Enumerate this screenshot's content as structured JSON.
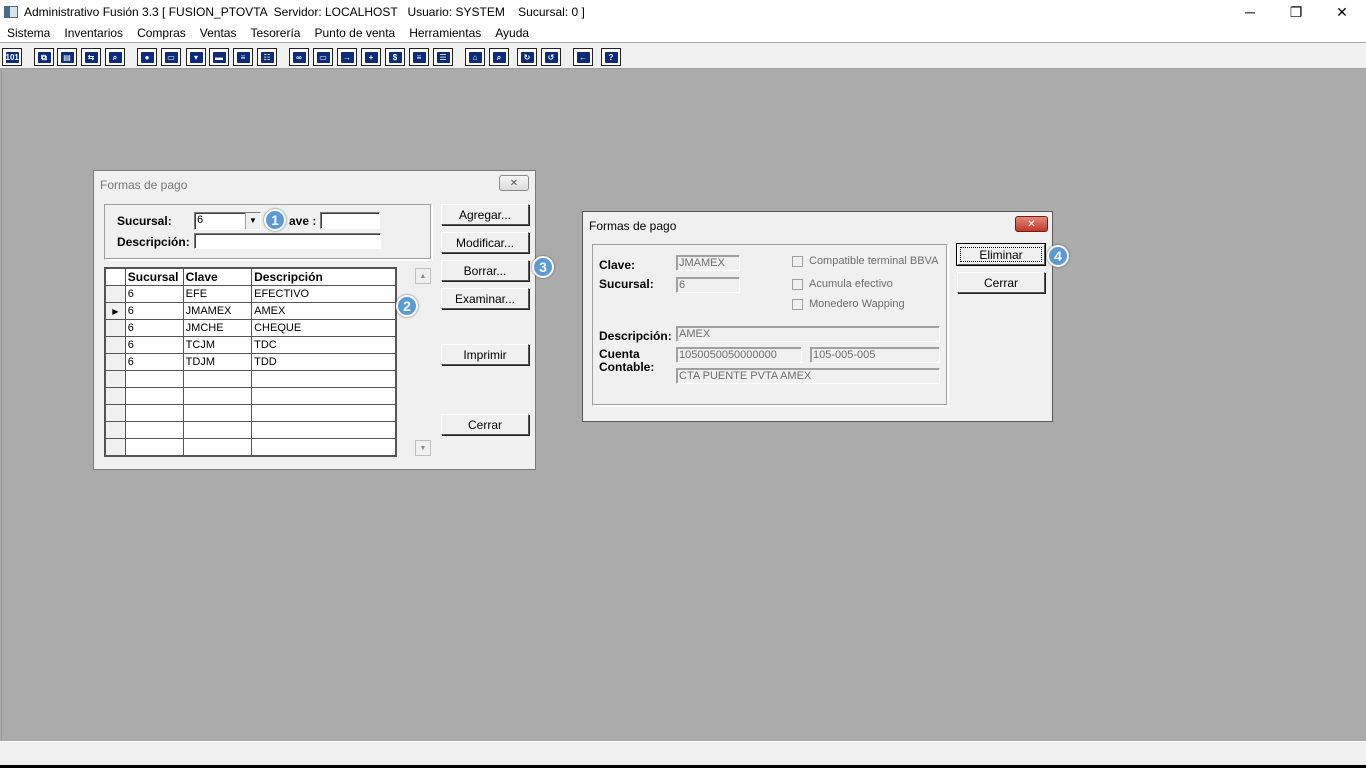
{
  "window": {
    "title": "Administrativo Fusión 3.3 [ FUSION_PTOVTA  Servidor: LOCALHOST   Usuario: SYSTEM    Sucursal: 0 ]",
    "minimize": "─",
    "restore": "❐",
    "close": "✕"
  },
  "menu": [
    "Sistema",
    "Inventarios",
    "Compras",
    "Ventas",
    "Tesorería",
    "Punto de venta",
    "Herramientas",
    "Ayuda"
  ],
  "toolbar_icons": [
    "calculator-icon",
    "copy-icon",
    "paste-icon",
    "exchange-icon",
    "search-doc-icon",
    "person-icon",
    "folder-icon",
    "print-icon",
    "printer-icon",
    "document-icon",
    "table-icon",
    "binoculars-icon",
    "box-icon",
    "export-icon",
    "add-icon",
    "dollar-icon",
    "report-icon",
    "list-icon",
    "home-icon",
    "zoom-icon",
    "refresh-icon",
    "undo-icon",
    "back-icon",
    "help-icon"
  ],
  "list_dialog": {
    "title": "Formas de pago",
    "sucursal_label": "Sucursal:",
    "sucursal_value": "6",
    "clave_label": "ave :",
    "clave_value": "",
    "descripcion_label": "Descripción:",
    "descripcion_value": "",
    "buttons": {
      "agregar": "Agregar...",
      "modificar": "Modificar...",
      "borrar": "Borrar...",
      "examinar": "Examinar...",
      "imprimir": "Imprimir",
      "cerrar": "Cerrar"
    },
    "grid": {
      "columns": [
        "Sucursal",
        "Clave",
        "Descripción"
      ],
      "rows": [
        {
          "indicator": "",
          "sucursal": "6",
          "clave": "EFE",
          "descripcion": "EFECTIVO"
        },
        {
          "indicator": "▶",
          "sucursal": "6",
          "clave": "JMAMEX",
          "descripcion": "AMEX"
        },
        {
          "indicator": "",
          "sucursal": "6",
          "clave": "JMCHE",
          "descripcion": "CHEQUE"
        },
        {
          "indicator": "",
          "sucursal": "6",
          "clave": "TCJM",
          "descripcion": "TDC"
        },
        {
          "indicator": "",
          "sucursal": "6",
          "clave": "TDJM",
          "descripcion": "TDD"
        }
      ],
      "empty_rows": 5
    }
  },
  "detail_dialog": {
    "title": "Formas de pago",
    "clave_label": "Clave:",
    "clave_value": "JMAMEX",
    "sucursal_label": "Sucursal:",
    "sucursal_value": "6",
    "checkboxes": [
      "Compatible terminal BBVA",
      "Acumula efectivo",
      "Monedero Wapping"
    ],
    "descripcion_label": "Descripción:",
    "descripcion_value": "AMEX",
    "cuenta_label_1": "Cuenta",
    "cuenta_label_2": "Contable:",
    "cuenta_value": "1050050050000000",
    "cuenta_code": "105-005-005",
    "cuenta_desc": "CTA PUENTE PVTA AMEX",
    "eliminar": "Eliminar",
    "cerrar": "Cerrar"
  },
  "callouts": [
    "1",
    "2",
    "3",
    "4"
  ],
  "accent_color": "#5b9bd5"
}
